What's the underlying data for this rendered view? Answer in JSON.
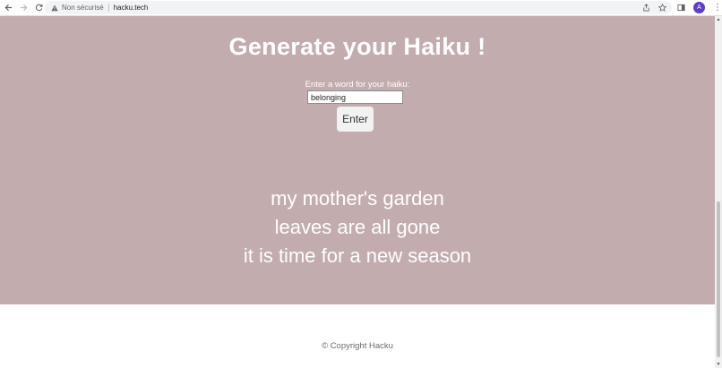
{
  "browser": {
    "back_icon": "arrow-left-icon",
    "forward_icon": "arrow-right-icon",
    "reload_icon": "reload-icon",
    "security_warning": "Non sécurisé",
    "url": "hacku.tech",
    "avatar_letter": "A",
    "avatar_color": "#5b3dc8"
  },
  "page": {
    "title": "Generate your Haiku !",
    "word_label": "Enter a word for your haiku:",
    "word_value": "belonging",
    "enter_label": "Enter",
    "haiku_lines": [
      "my mother's garden",
      "leaves are all gone",
      "it is time for a new season"
    ],
    "hero_background": "#c3acae"
  },
  "footer": {
    "copyright": "© Copyright Hacku"
  }
}
